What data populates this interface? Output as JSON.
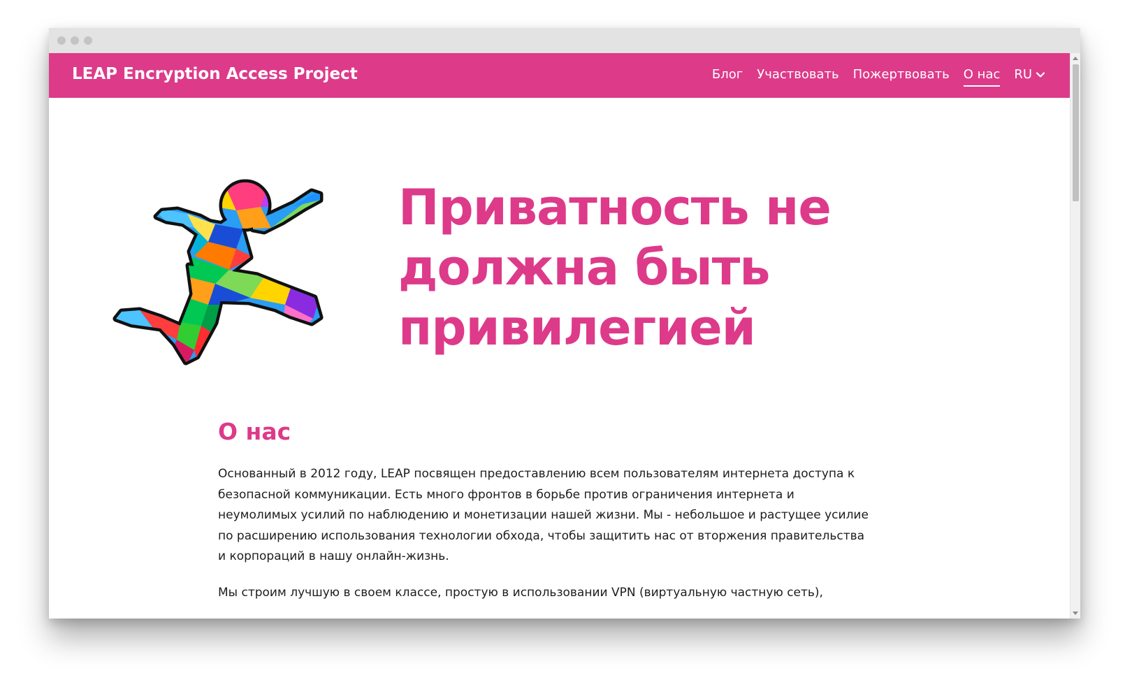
{
  "header": {
    "brand": "LEAP Encryption Access Project",
    "nav": [
      {
        "label": "Блог"
      },
      {
        "label": "Участвовать"
      },
      {
        "label": "Пожертвовать"
      },
      {
        "label": "О нас"
      }
    ],
    "language": "RU"
  },
  "hero": {
    "title": "Приватность не должна быть привилегией"
  },
  "about": {
    "heading": "О нас",
    "paragraph1": "Основанный в 2012 году, LEAP посвящен предоставлению всем пользователям интернета доступа к безопасной коммуникации. Есть много фронтов в борьбе против ограничения интернета и неумолимых усилий по наблюдению и монетизации нашей жизни. Мы - небольшое и растущее усилие по расширению использования технологии обхода, чтобы защитить нас от вторжения правительства и корпораций в нашу онлайн-жизнь.",
    "paragraph2": "Мы строим лучшую в своем классе, простую в использовании VPN (виртуальную частную сеть),"
  },
  "colors": {
    "brand": "#dd3a8a",
    "text": "#1d1d1d",
    "chrome": "#e3e3e3"
  }
}
